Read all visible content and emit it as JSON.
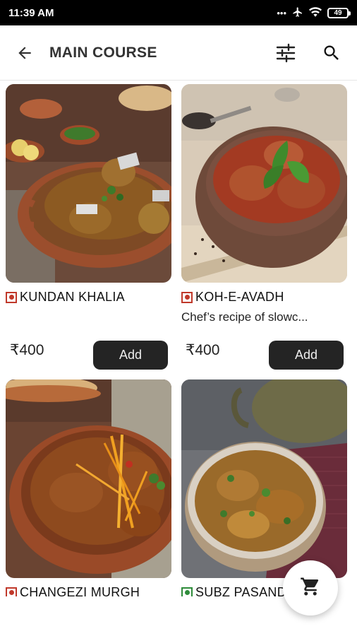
{
  "status_bar": {
    "time": "11:39 AM",
    "signal": "•••",
    "battery": "49"
  },
  "app_bar": {
    "title": "MAIN COURSE"
  },
  "icons": {
    "back": "arrow-back-icon",
    "filter": "filter-sliders-icon",
    "search": "search-icon",
    "cart": "cart-icon"
  },
  "items": [
    {
      "name": "KUNDAN KHALIA",
      "description": "",
      "price": "₹400",
      "add_label": "Add",
      "diet": "non-veg"
    },
    {
      "name": "KOH-E-AVADH",
      "description": "Chef’s recipe of slowc...",
      "price": "₹400",
      "add_label": "Add",
      "diet": "non-veg"
    },
    {
      "name": "CHANGEZI MURGH",
      "description": "",
      "price": "",
      "add_label": "",
      "diet": "non-veg"
    },
    {
      "name": "SUBZ PASANDA",
      "description": "",
      "price": "",
      "add_label": "",
      "diet": "veg"
    }
  ],
  "colors": {
    "non_veg": "#c0392b",
    "veg": "#2e8b3a",
    "add_button": "#242424"
  }
}
